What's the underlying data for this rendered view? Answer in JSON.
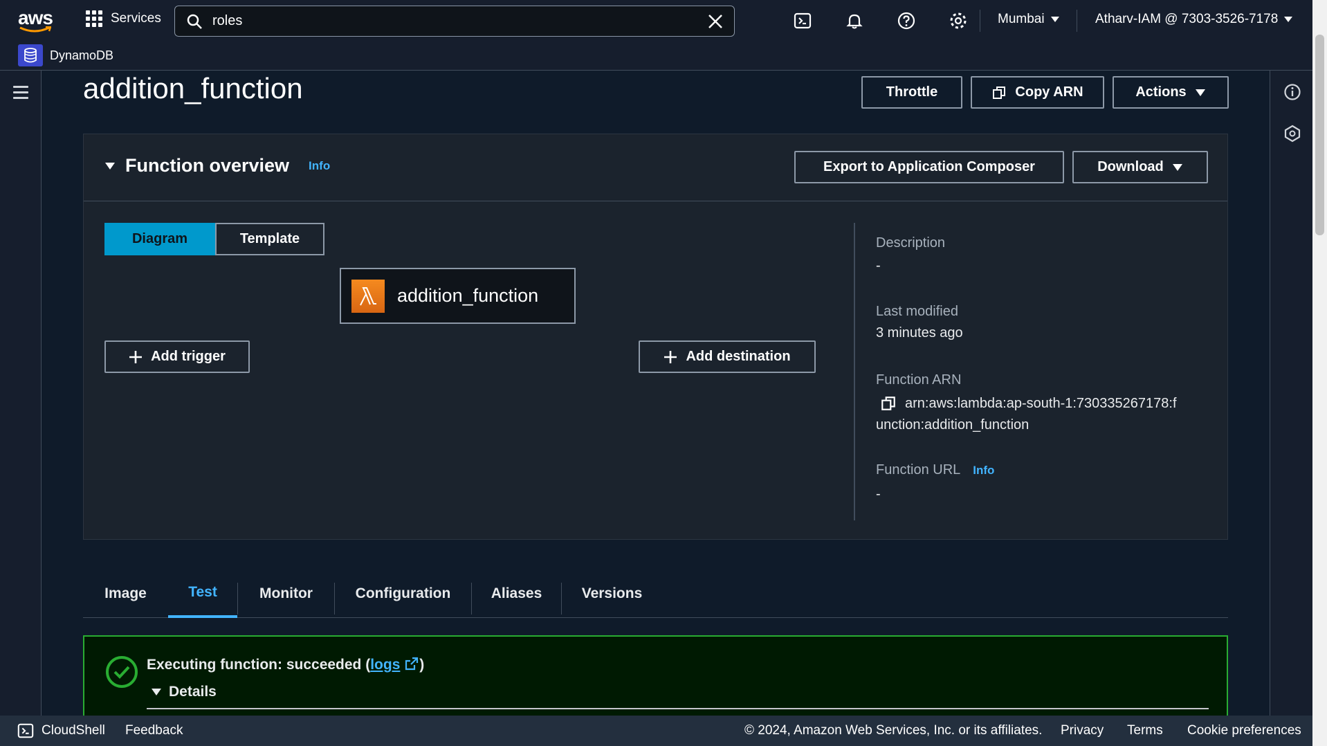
{
  "nav": {
    "logo_text": "aws",
    "services_label": "Services",
    "search_value": "roles",
    "region": "Mumbai",
    "account": "Atharv-IAM @ 7303-3526-7178"
  },
  "favorites": {
    "item": "DynamoDB"
  },
  "header": {
    "title": "addition_function",
    "throttle_label": "Throttle",
    "copy_arn_label": "Copy ARN",
    "actions_label": "Actions"
  },
  "overview": {
    "title": "Function overview",
    "info_label": "Info",
    "export_label": "Export to Application Composer",
    "download_label": "Download",
    "seg_diagram": "Diagram",
    "seg_template": "Template",
    "function_box_label": "addition_function",
    "add_trigger_label": "Add trigger",
    "add_destination_label": "Add destination",
    "description_label": "Description",
    "description_value": "-",
    "last_modified_label": "Last modified",
    "last_modified_value": "3 minutes ago",
    "arn_label": "Function ARN",
    "arn_line1": "arn:aws:lambda:ap-south-1:730335267178:f",
    "arn_line2": "unction:addition_function",
    "url_label": "Function URL",
    "url_info": "Info",
    "url_value": "-"
  },
  "tabs": [
    "Image",
    "Test",
    "Monitor",
    "Configuration",
    "Aliases",
    "Versions"
  ],
  "active_tab": "Test",
  "alert": {
    "text_before": "Executing function: succeeded (",
    "link": "logs",
    "text_after": ")",
    "details_label": "Details"
  },
  "footer": {
    "cloudshell": "CloudShell",
    "feedback": "Feedback",
    "copyright": "© 2024, Amazon Web Services, Inc. or its affiliates.",
    "privacy": "Privacy",
    "terms": "Terms",
    "cookies": "Cookie preferences"
  },
  "colors": {
    "accent": "#42b4ff",
    "success": "#29ad32",
    "lambda": "#f58a1f"
  }
}
